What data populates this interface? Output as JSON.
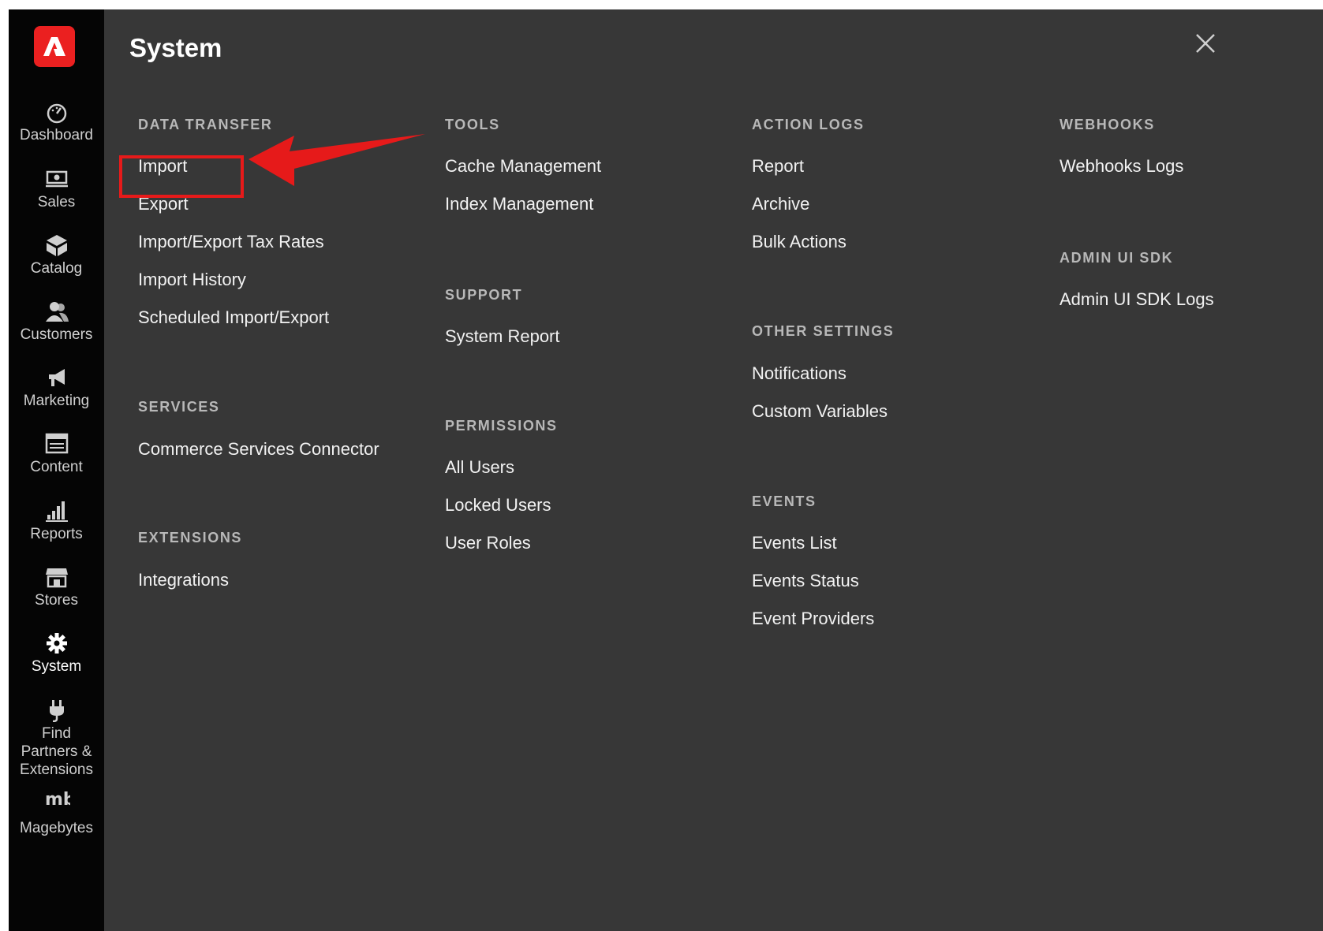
{
  "panel": {
    "title": "System",
    "close_icon": "close-icon"
  },
  "logo": {
    "icon": "adobe-logo-icon",
    "color": "#eb2020"
  },
  "sidebar": {
    "items": [
      {
        "label": "Dashboard",
        "icon": "dashboard-icon"
      },
      {
        "label": "Sales",
        "icon": "sales-icon"
      },
      {
        "label": "Catalog",
        "icon": "catalog-icon"
      },
      {
        "label": "Customers",
        "icon": "customers-icon"
      },
      {
        "label": "Marketing",
        "icon": "marketing-icon"
      },
      {
        "label": "Content",
        "icon": "content-icon"
      },
      {
        "label": "Reports",
        "icon": "reports-icon"
      },
      {
        "label": "Stores",
        "icon": "stores-icon"
      },
      {
        "label": "System",
        "icon": "gear-icon",
        "active": true
      },
      {
        "label": "Find Partners & Extensions",
        "icon": "plug-icon"
      },
      {
        "label": "Magebytes",
        "icon": "magebytes-icon"
      }
    ]
  },
  "columns": [
    {
      "sections": [
        {
          "title": "DATA TRANSFER",
          "links": [
            "Import",
            "Export",
            "Import/Export Tax Rates",
            "Import History",
            "Scheduled Import/Export"
          ]
        },
        {
          "title": "SERVICES",
          "links": [
            "Commerce Services Connector"
          ]
        },
        {
          "title": "EXTENSIONS",
          "links": [
            "Integrations"
          ]
        }
      ]
    },
    {
      "sections": [
        {
          "title": "TOOLS",
          "links": [
            "Cache Management",
            "Index Management"
          ]
        },
        {
          "title": "SUPPORT",
          "links": [
            "System Report"
          ]
        },
        {
          "title": "PERMISSIONS",
          "links": [
            "All Users",
            "Locked Users",
            "User Roles"
          ]
        }
      ]
    },
    {
      "sections": [
        {
          "title": "ACTION LOGS",
          "links": [
            "Report",
            "Archive",
            "Bulk Actions"
          ]
        },
        {
          "title": "OTHER SETTINGS",
          "links": [
            "Notifications",
            "Custom Variables"
          ]
        },
        {
          "title": "EVENTS",
          "links": [
            "Events List",
            "Events Status",
            "Event Providers"
          ]
        }
      ]
    },
    {
      "sections": [
        {
          "title": "WEBHOOKS",
          "links": [
            "Webhooks Logs"
          ]
        },
        {
          "title": "ADMIN UI SDK",
          "links": [
            "Admin UI SDK Logs"
          ]
        }
      ]
    }
  ],
  "annotation": {
    "color": "#e61a1a",
    "highlighted_link": "Import"
  }
}
